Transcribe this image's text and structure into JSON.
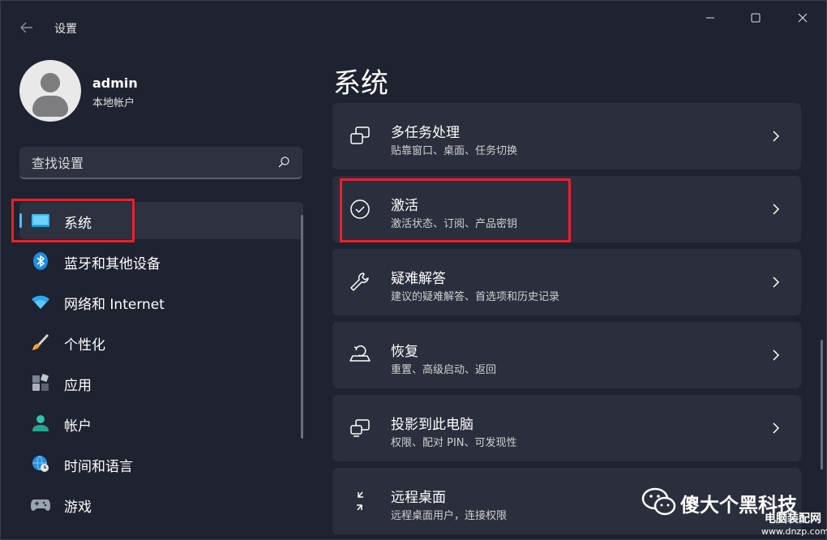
{
  "window": {
    "title": "设置",
    "controls": {
      "minimize": "—",
      "maximize": "☐",
      "close": "✕"
    }
  },
  "user": {
    "name": "admin",
    "account_type": "本地帐户"
  },
  "search": {
    "placeholder": "查找设置"
  },
  "sidebar": {
    "items": [
      {
        "label": "系统",
        "icon": "monitor-icon",
        "selected": true
      },
      {
        "label": "蓝牙和其他设备",
        "icon": "bluetooth-icon"
      },
      {
        "label": "网络和 Internet",
        "icon": "wifi-icon"
      },
      {
        "label": "个性化",
        "icon": "brush-icon"
      },
      {
        "label": "应用",
        "icon": "apps-icon"
      },
      {
        "label": "帐户",
        "icon": "account-icon"
      },
      {
        "label": "时间和语言",
        "icon": "globe-clock-icon"
      },
      {
        "label": "游戏",
        "icon": "gamepad-icon"
      }
    ]
  },
  "main": {
    "title": "系统",
    "cards": [
      {
        "title": "多任务处理",
        "subtitle": "贴靠窗口、桌面、任务切换",
        "icon": "multitasking-icon"
      },
      {
        "title": "激活",
        "subtitle": "激活状态、订阅、产品密钥",
        "icon": "activation-check-icon"
      },
      {
        "title": "疑难解答",
        "subtitle": "建议的疑难解答、首选项和历史记录",
        "icon": "wrench-icon"
      },
      {
        "title": "恢复",
        "subtitle": "重置、高级启动、返回",
        "icon": "recovery-icon"
      },
      {
        "title": "投影到此电脑",
        "subtitle": "权限、配对 PIN、可发现性",
        "icon": "projection-icon"
      },
      {
        "title": "远程桌面",
        "subtitle": "远程桌面用户，连接权限",
        "icon": "remote-desktop-icon"
      }
    ]
  },
  "watermark": {
    "text": "傻大个黑科技",
    "site": "电脑装配网",
    "url": "www.dnzp.com"
  },
  "colors": {
    "accent": "#4cc2ff",
    "highlight": "#e8212e",
    "background": "#1f2230",
    "card": "#2b2f3d"
  }
}
